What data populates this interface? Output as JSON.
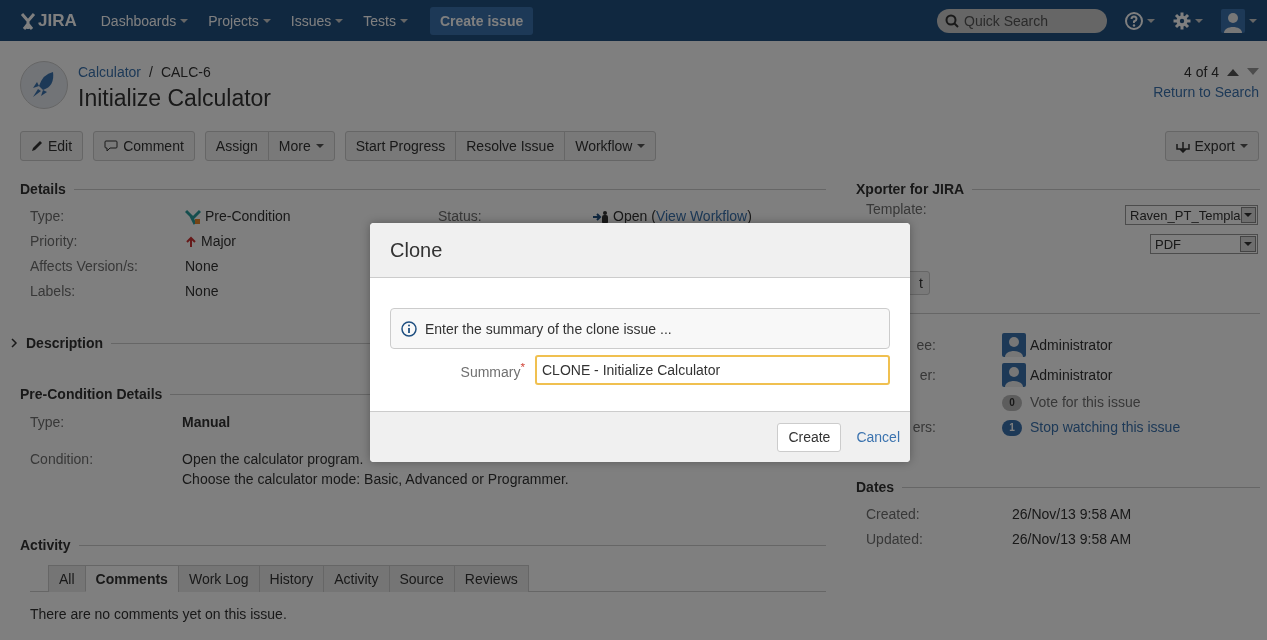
{
  "header": {
    "logo": "JIRA",
    "nav": [
      {
        "label": "Dashboards"
      },
      {
        "label": "Projects"
      },
      {
        "label": "Issues"
      },
      {
        "label": "Tests"
      }
    ],
    "create": "Create issue",
    "search": {
      "placeholder": "Quick Search"
    }
  },
  "issue": {
    "project": "Calculator",
    "separator": "/",
    "key": "CALC-6",
    "title": "Initialize Calculator",
    "pager": "4 of 4",
    "return": "Return to Search"
  },
  "toolbar": [
    [
      "Edit",
      "Comment"
    ],
    [
      "Assign",
      "More"
    ],
    [
      "Start Progress",
      "Resolve Issue",
      "Workflow"
    ]
  ],
  "export": "Export",
  "details": {
    "heading": "Details",
    "rows": [
      {
        "label": "Type:",
        "value": "Pre-Condition",
        "kind": "type"
      },
      {
        "label": "Priority:",
        "value": "Major",
        "kind": "priority"
      },
      {
        "label": "Affects Version/s:",
        "value": "None",
        "kind": "plain"
      },
      {
        "label": "Labels:",
        "value": "None",
        "kind": "plain"
      }
    ],
    "status": {
      "label": "Status:",
      "value": "Open",
      "link_open": "(",
      "link": "View Workflow",
      "link_close": ")"
    }
  },
  "description": {
    "heading": "Description",
    "expanded": false
  },
  "precondition": {
    "heading": "Pre-Condition Details",
    "type_label": "Type:",
    "type_value": "Manual",
    "condition_label": "Condition:",
    "condition_lines": [
      "Open the calculator program.",
      "Choose the calculator mode: Basic, Advanced or Programmer."
    ]
  },
  "activity": {
    "heading": "Activity",
    "tabs": [
      {
        "label": "All",
        "selected": false
      },
      {
        "label": "Comments",
        "selected": true
      },
      {
        "label": "Work Log",
        "selected": false
      },
      {
        "label": "History",
        "selected": false
      },
      {
        "label": "Activity",
        "selected": false
      },
      {
        "label": "Source",
        "selected": false
      },
      {
        "label": "Reviews",
        "selected": false
      }
    ],
    "empty": "There are no comments yet on this issue."
  },
  "xporter": {
    "heading": "Xporter for JIRA",
    "template_label": "Template:",
    "template": "Raven_PT_Templa",
    "format": "PDF",
    "button": "t"
  },
  "people": [
    {
      "label": "ee:",
      "value": "Administrator",
      "kind": "user"
    },
    {
      "label": "er:",
      "value": "Administrator",
      "kind": "user"
    },
    {
      "value": "Vote for this issue",
      "count": "0",
      "kind": "vote"
    },
    {
      "label": "ers:",
      "value": "Stop watching this issue",
      "count": "1",
      "kind": "watch"
    }
  ],
  "dates": {
    "heading": "Dates",
    "rows": [
      {
        "label": "Created:",
        "value": "26/Nov/13 9:58 AM"
      },
      {
        "label": "Updated:",
        "value": "26/Nov/13 9:58 AM"
      }
    ]
  },
  "dialog": {
    "title": "Clone",
    "info": "Enter the summary of the clone issue ...",
    "summary_label": "Summary",
    "required_mark": "*",
    "summary_value": "CLONE - Initialize Calculator",
    "create": "Create",
    "cancel": "Cancel"
  }
}
